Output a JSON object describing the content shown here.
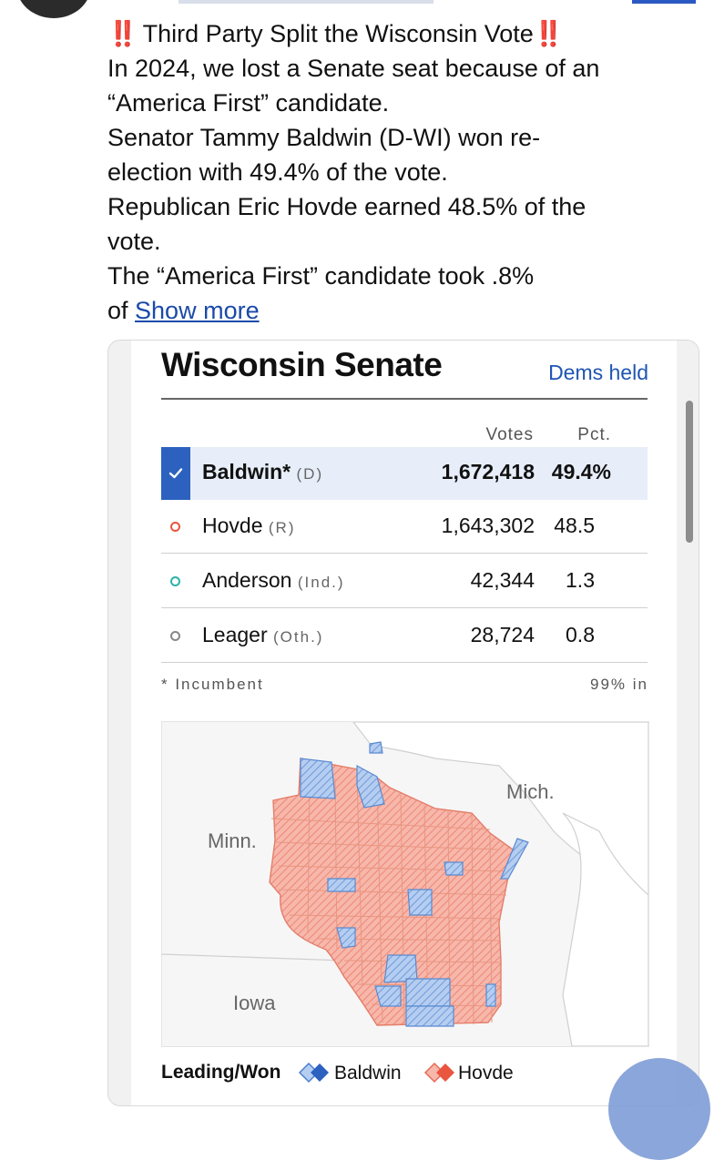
{
  "post": {
    "title_mark_left": "‼️",
    "title": "Third Party Split the Wisconsin Vote",
    "title_mark_right": "‼️",
    "lines": [
      "In 2024, we lost a Senate seat because of an",
      "“America First” candidate.",
      "Senator Tammy Baldwin (D-WI) won re-",
      "election with 49.4% of the vote.",
      "Republican Eric Hovde earned 48.5% of the",
      "vote.",
      "The “America First” candidate took .8%"
    ],
    "last_prefix": "of ",
    "show_more": "Show more"
  },
  "widget": {
    "title": "Wisconsin Senate",
    "status": "Dems held",
    "col_votes": "Votes",
    "col_pct": "Pct.",
    "candidates": [
      {
        "name": "Baldwin*",
        "party": "(D)",
        "votes": "1,672,418",
        "pct": "49.4%",
        "color": "#2c61bf"
      },
      {
        "name": "Hovde",
        "party": "(R)",
        "votes": "1,643,302",
        "pct": "48.5",
        "color": "#e9553f"
      },
      {
        "name": "Anderson",
        "party": "(Ind.)",
        "votes": "42,344",
        "pct": "1.3",
        "color": "#2bb3a8"
      },
      {
        "name": "Leager",
        "party": "(Oth.)",
        "votes": "28,724",
        "pct": "0.8",
        "color": "#888888"
      }
    ],
    "footnote": "* Incumbent",
    "reporting": "99% in",
    "map_labels": {
      "minn": "Minn.",
      "mich": "Mich.",
      "iowa": "Iowa"
    },
    "legend": {
      "title": "Leading/Won",
      "baldwin": "Baldwin",
      "hovde": "Hovde"
    },
    "colors": {
      "dem_fill": "#a9c4ec",
      "dem_stroke": "#4a7fd0",
      "rep_fill": "#f6b1a6",
      "rep_stroke": "#e66a55"
    }
  }
}
